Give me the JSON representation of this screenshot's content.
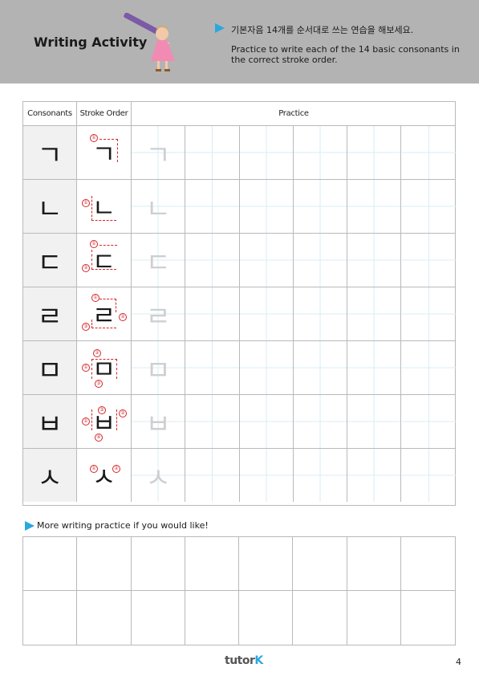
{
  "header": {
    "title": "Writing Activity",
    "instruction_ko": "기본자음 14개를 순서대로 쓰는 연습을 해보세요.",
    "instruction_en": "Practice to write each of the 14 basic consonants in the correct stroke order."
  },
  "table": {
    "col_consonants": "Consonants",
    "col_stroke_order": "Stroke Order",
    "col_practice": "Practice",
    "rows": [
      {
        "char": "ㄱ",
        "nums": [
          "①"
        ]
      },
      {
        "char": "ㄴ",
        "nums": [
          "①"
        ]
      },
      {
        "char": "ㄷ",
        "nums": [
          "①",
          "②"
        ]
      },
      {
        "char": "ㄹ",
        "nums": [
          "①",
          "②",
          "③"
        ]
      },
      {
        "char": "ㅁ",
        "nums": [
          "①",
          "②",
          "③"
        ]
      },
      {
        "char": "ㅂ",
        "nums": [
          "①",
          "②",
          "③",
          "④"
        ]
      },
      {
        "char": "ㅅ",
        "nums": [
          "①",
          "②"
        ]
      }
    ]
  },
  "more_practice": "More writing practice if you would like!",
  "footer": {
    "logo_main": "tutor",
    "logo_accent": "K",
    "page_number": "4"
  },
  "colors": {
    "banner": "#b3b3b3",
    "accent_blue": "#29a8e0",
    "stroke_red": "#d3262c"
  }
}
